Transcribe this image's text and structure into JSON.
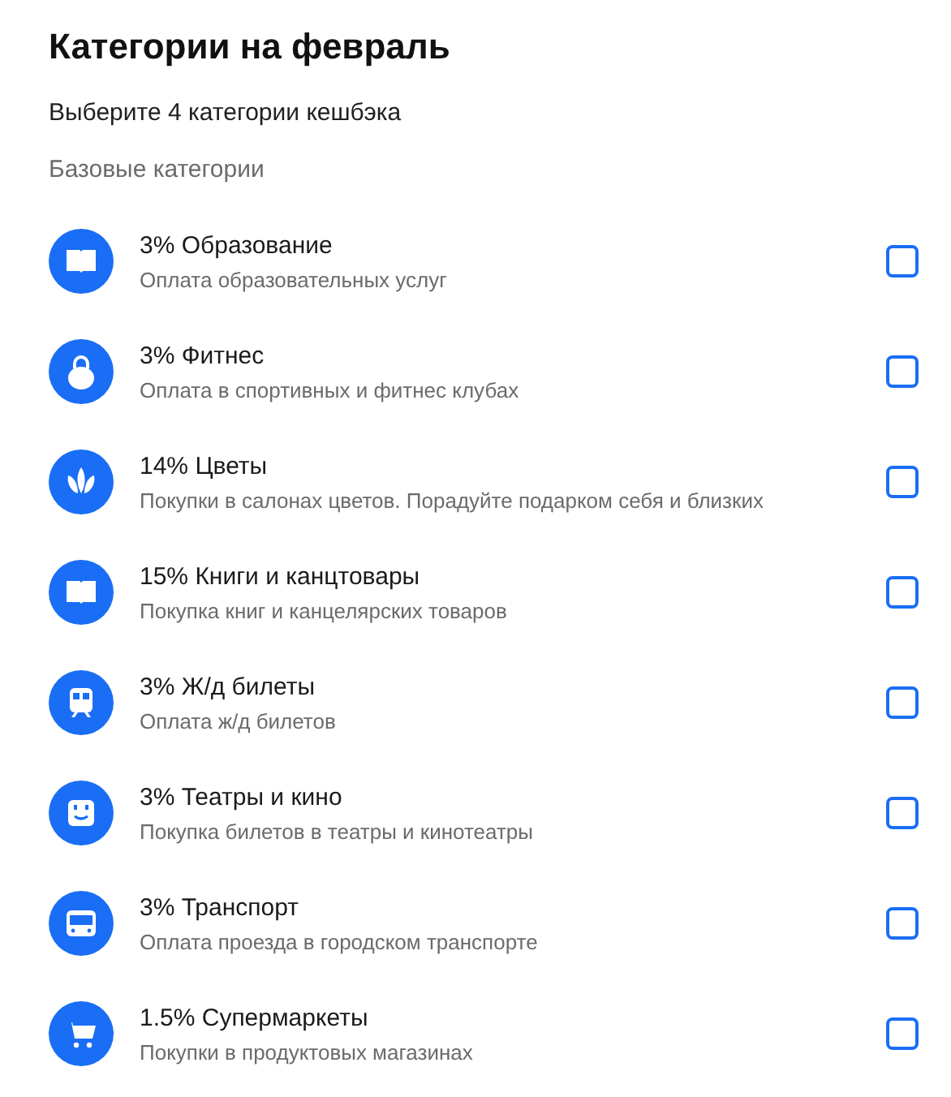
{
  "title": "Категории на февраль",
  "subtitle": "Выберите 4 категории кешбэка",
  "section": "Базовые категории",
  "categories": [
    {
      "kind": "book",
      "name": "3% Образование",
      "description": "Оплата образовательных услуг",
      "checked": false
    },
    {
      "kind": "kettlebell",
      "name": "3% Фитнес",
      "description": "Оплата в спортивных и фитнес клубах",
      "checked": false
    },
    {
      "kind": "flower",
      "name": "14% Цветы",
      "description": "Покупки в салонах цветов. Порадуйте подарком себя и близких",
      "checked": false
    },
    {
      "kind": "book",
      "name": "15% Книги и канцтовары",
      "description": "Покупка книг и канцелярских товаров",
      "checked": false
    },
    {
      "kind": "train",
      "name": "3% Ж/д билеты",
      "description": "Оплата ж/д билетов",
      "checked": false
    },
    {
      "kind": "face",
      "name": "3% Театры и кино",
      "description": "Покупка билетов в театры и кинотеатры",
      "checked": false
    },
    {
      "kind": "bus",
      "name": "3% Транспорт",
      "description": "Оплата проезда в городском транспорте",
      "checked": false
    },
    {
      "kind": "cart",
      "name": "1.5% Супермаркеты",
      "description": "Покупки в продуктовых магазинах",
      "checked": false
    }
  ]
}
